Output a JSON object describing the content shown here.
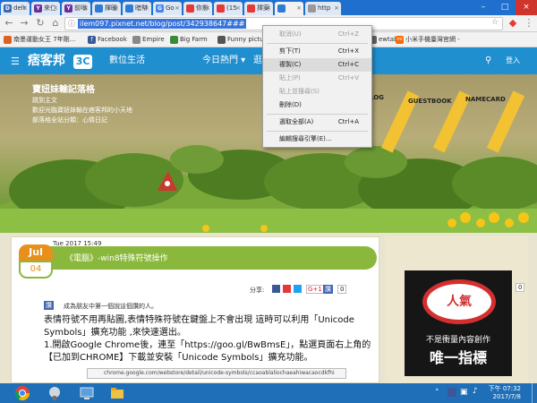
{
  "tabs": [
    {
      "icon": "D",
      "label": "delt",
      "color": "#3a67b0"
    },
    {
      "icon": "Y",
      "label": "來仁",
      "color": "#6b2d9a"
    },
    {
      "icon": "Y",
      "label": "前嗡",
      "color": "#6b2d9a"
    },
    {
      "icon": "",
      "label": "揮暖",
      "color": "#2e7bd6"
    },
    {
      "icon": "",
      "label": "暗幇",
      "color": "#2e7bd6"
    },
    {
      "icon": "G",
      "label": "Go",
      "color": "#4285f4"
    },
    {
      "icon": "",
      "label": "你影",
      "color": "#e53935"
    },
    {
      "icon": "",
      "label": "(15",
      "color": "#e53935"
    },
    {
      "icon": "",
      "label": "擇案",
      "color": "#e53935"
    },
    {
      "icon": "",
      "label": "",
      "color": "#2e7bd6"
    },
    {
      "icon": "",
      "label": "http",
      "color": "#999999"
    }
  ],
  "address": {
    "url": "ilem097.pixnet.net/blog/post/342938647###"
  },
  "bookmarks": [
    {
      "label": "南墨運動女王 7年剛...",
      "icon": "",
      "color": "#e06020"
    },
    {
      "label": "Facebook",
      "icon": "f",
      "color": "#3b5998"
    },
    {
      "label": "Empire",
      "icon": "",
      "color": "#888888"
    },
    {
      "label": "Big Farm",
      "icon": "",
      "color": "#3a8a3a"
    },
    {
      "label": "Funny pictu...",
      "icon": "",
      "color": "#555555"
    },
    {
      "label": "ewtab",
      "icon": "",
      "color": "#666666"
    },
    {
      "label": "小米手機臺灣官網 -",
      "icon": "mi",
      "color": "#ff6700"
    }
  ],
  "site": {
    "brand": "痞客邦",
    "brand_sub": "3C",
    "section": "數位生活",
    "nav": [
      "今日熱門",
      "逛"
    ],
    "login": "登入"
  },
  "blog": {
    "title": "寶妞妹輸記落格",
    "subtitle": "跳到主文",
    "desc1": "歡迎光臨寶妞妹輸在痞客邦的小天地",
    "desc2": "部落格全站分類：心情日記",
    "deco": [
      "LOG",
      "GUESTBOOK",
      "NAMECARD"
    ]
  },
  "post": {
    "month": "Jul",
    "day": "04",
    "datetime": "Tue 2017 15:49",
    "title": "《電腦》-win8特殊符號操作",
    "share_label": "分享:",
    "like_count": "0",
    "like_label": "讚",
    "like_text": "成為朋友中第一個說這個讚的人。",
    "para1": "表情符號不用再貼圖,表情特殊符號在鍵盤上不會出現 這時可以利用「Unicode Symbols」擴充功能 ,來快速選出。",
    "para2": "1.開啟Google Chrome後，連至「https://goo.gl/BwBmsE」，點選頁面右上角的【已加到CHROME】下載並安裝「Unicode Symbols」擴充功能。",
    "screenshot_url": "chrome.google.com/webstore/detail/unicode-symbols/ccaoablaliochaeahiwacaocdkfhi"
  },
  "sidebar": {
    "like_count": "0",
    "like_label": "讚",
    "ad_badge": "人氣",
    "ad_line1": "不是衝量內容創作",
    "ad_line2": "唯一指標"
  },
  "context_menu": [
    {
      "label": "取消(U)",
      "shortcut": "Ctrl+Z",
      "disabled": true,
      "highlighted": false
    },
    {
      "label": "剪下(T)",
      "shortcut": "Ctrl+X",
      "disabled": false,
      "highlighted": false
    },
    {
      "label": "複製(C)",
      "shortcut": "Ctrl+C",
      "disabled": false,
      "highlighted": true
    },
    {
      "label": "貼上(P)",
      "shortcut": "Ctrl+V",
      "disabled": true,
      "highlighted": false
    },
    {
      "label": "貼上並搜尋(S)",
      "shortcut": "",
      "disabled": true,
      "highlighted": false
    },
    {
      "label": "刪除(D)",
      "shortcut": "",
      "disabled": false,
      "highlighted": false
    },
    {
      "label": "選取全部(A)",
      "shortcut": "Ctrl+A",
      "disabled": false,
      "highlighted": false
    },
    {
      "label": "編輯搜尋引擎(E)...",
      "shortcut": "",
      "disabled": false,
      "highlighted": false
    }
  ],
  "taskbar": {
    "time": "下午 07:32",
    "date": "2017/7/8"
  },
  "colors": {
    "chrome_blue": "#1f6fcf",
    "site_blue": "#1f8fd0",
    "post_green": "#8ab83c",
    "badge_orange": "#e8901c",
    "taskbar": "#1e6fb8"
  }
}
